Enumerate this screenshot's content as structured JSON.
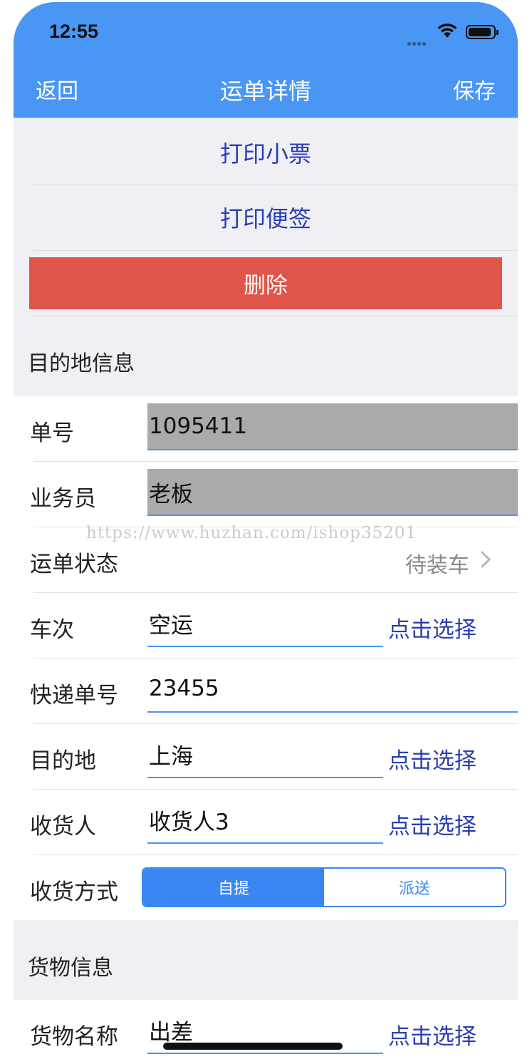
{
  "status_bar": {
    "time": "12:55"
  },
  "nav": {
    "back_label": "返回",
    "title": "运单详情",
    "save_label": "保存"
  },
  "actions": {
    "print_receipt": "打印小票",
    "print_label": "打印便签",
    "delete": "删除"
  },
  "destination_section": {
    "header": "目的地信息",
    "order_no": {
      "label": "单号",
      "value": "1095411"
    },
    "salesman": {
      "label": "业务员",
      "value": "老板"
    },
    "waybill_status": {
      "label": "运单状态",
      "value": "待装车"
    },
    "trip": {
      "label": "车次",
      "value": "空运",
      "pick": "点击选择"
    },
    "express_no": {
      "label": "快递单号",
      "value": "23455"
    },
    "destination": {
      "label": "目的地",
      "value": "上海",
      "pick": "点击选择"
    },
    "consignee": {
      "label": "收货人",
      "value": "收货人3",
      "pick": "点击选择"
    },
    "delivery_method": {
      "label": "收货方式",
      "options": [
        "自提",
        "派送"
      ],
      "selected": "自提"
    }
  },
  "cargo_section": {
    "header": "货物信息",
    "cargo_name": {
      "label": "货物名称",
      "value": "出差",
      "pick": "点击选择"
    }
  },
  "watermark": "https://www.huzhan.com/ishop35201",
  "colors": {
    "nav_bg": "#4996f4",
    "delete_bg": "#e0554a",
    "link": "#2b3eb1",
    "accent": "#3a86f3"
  }
}
